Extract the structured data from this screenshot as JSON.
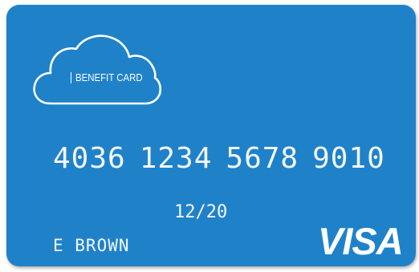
{
  "card": {
    "logo_label": "BENEFIT CARD",
    "number_groups": [
      "4036",
      "1234",
      "5678",
      "9010"
    ],
    "expiry": "12/20",
    "holder_name": "E BROWN",
    "brand": "VISA",
    "icon": "cloud-icon",
    "colors": {
      "card_background": "#1f82c9",
      "text": "#ffffff"
    }
  }
}
